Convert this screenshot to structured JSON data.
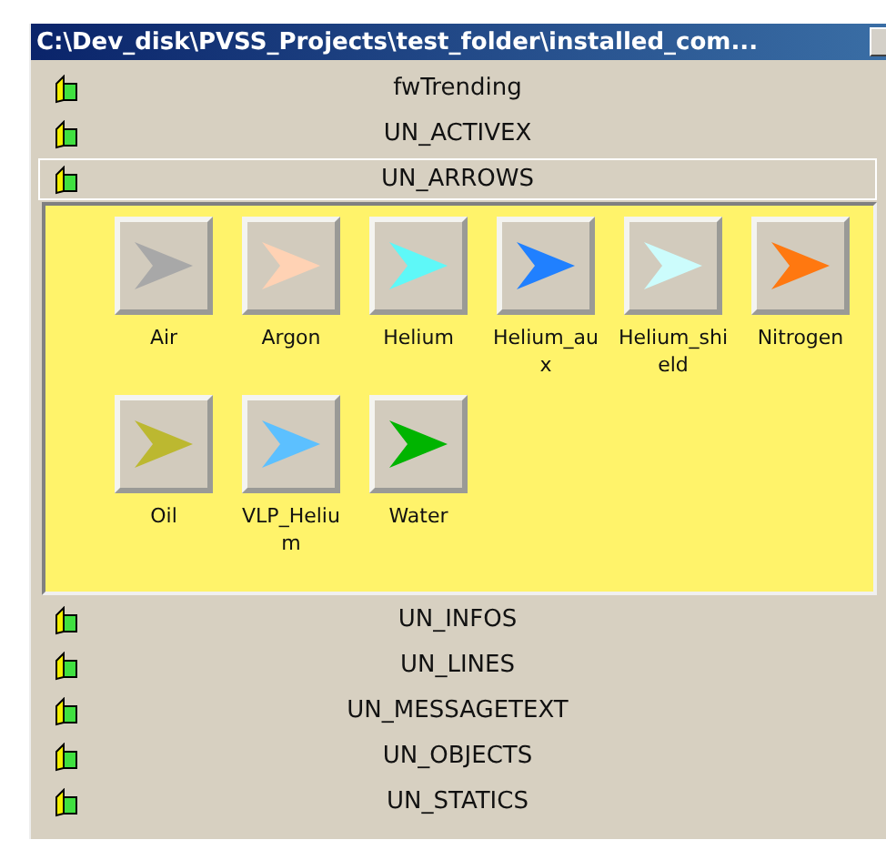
{
  "window": {
    "title": "C:\\Dev_disk\\PVSS_Projects\\test_folder\\installed_com..."
  },
  "categories": [
    {
      "label": "fwTrending",
      "expanded": false
    },
    {
      "label": "UN_ACTIVEX",
      "expanded": false
    },
    {
      "label": "UN_ARROWS",
      "expanded": true,
      "items": [
        {
          "label": "Air",
          "color": "#a8a8a8"
        },
        {
          "label": "Argon",
          "color": "#ffd2b4"
        },
        {
          "label": "Helium",
          "color": "#5ef8f8"
        },
        {
          "label": "Helium_aux",
          "color": "#2080ff"
        },
        {
          "label": "Helium_shield",
          "color": "#ccfcfc"
        },
        {
          "label": "Nitrogen",
          "color": "#ff7810"
        },
        {
          "label": "Oil",
          "color": "#bcb830"
        },
        {
          "label": "VLP_Helium",
          "color": "#5cc0ff"
        },
        {
          "label": "Water",
          "color": "#00b400"
        }
      ]
    },
    {
      "label": "UN_INFOS",
      "expanded": false
    },
    {
      "label": "UN_LINES",
      "expanded": false
    },
    {
      "label": "UN_MESSAGETEXT",
      "expanded": false
    },
    {
      "label": "UN_OBJECTS",
      "expanded": false
    },
    {
      "label": "UN_STATICS",
      "expanded": false
    }
  ]
}
